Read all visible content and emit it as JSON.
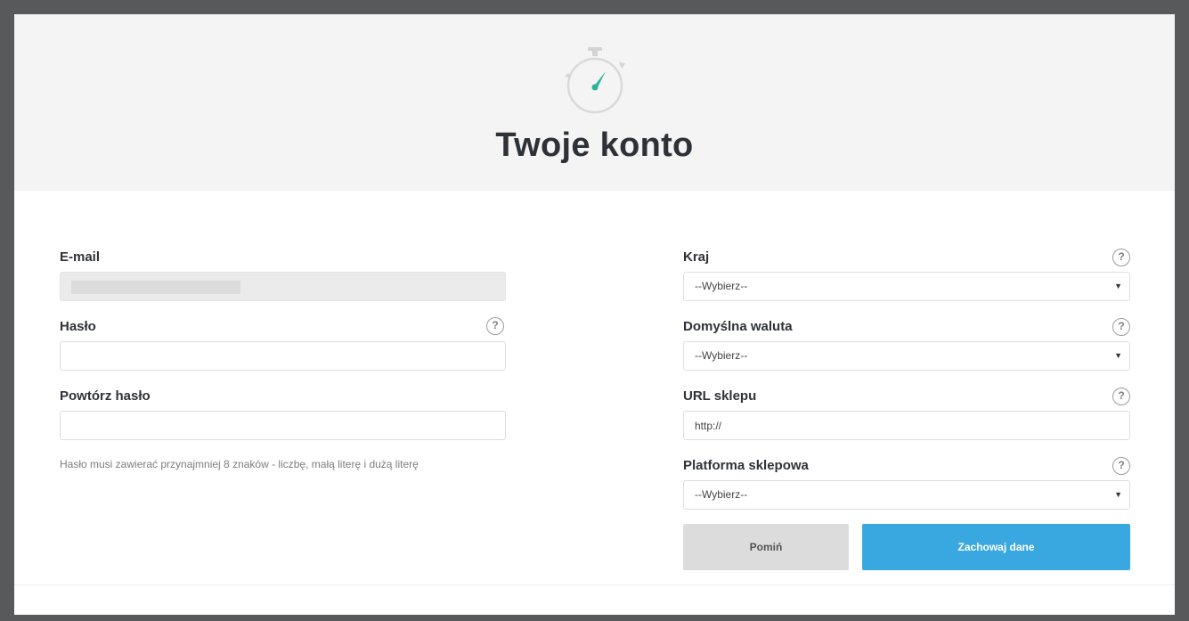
{
  "page": {
    "title": "Twoje konto"
  },
  "icons": {
    "hero": "stopwatch-icon",
    "help": "question-mark-icon",
    "select": "caret-down-icon"
  },
  "colors": {
    "accent": "#3aa8e0",
    "timer_needle": "#2bb39a",
    "hero_bg": "#f4f4f4"
  },
  "left": {
    "email": {
      "label": "E-mail"
    },
    "password": {
      "label": "Hasło",
      "value": ""
    },
    "password_repeat": {
      "label": "Powtórz hasło",
      "value": ""
    },
    "hint": "Hasło musi zawierać przynajmniej 8 znaków - liczbę, małą literę i dużą literę"
  },
  "right": {
    "country": {
      "label": "Kraj",
      "selected": "--Wybierz--"
    },
    "currency": {
      "label": "Domyślna waluta",
      "selected": "--Wybierz--"
    },
    "shop_url": {
      "label": "URL sklepu",
      "value": "http://"
    },
    "platform": {
      "label": "Platforma sklepowa",
      "selected": "--Wybierz--"
    }
  },
  "help_glyph": "?",
  "caret_glyph": "▼",
  "buttons": {
    "skip": "Pomiń",
    "save": "Zachowaj dane"
  }
}
